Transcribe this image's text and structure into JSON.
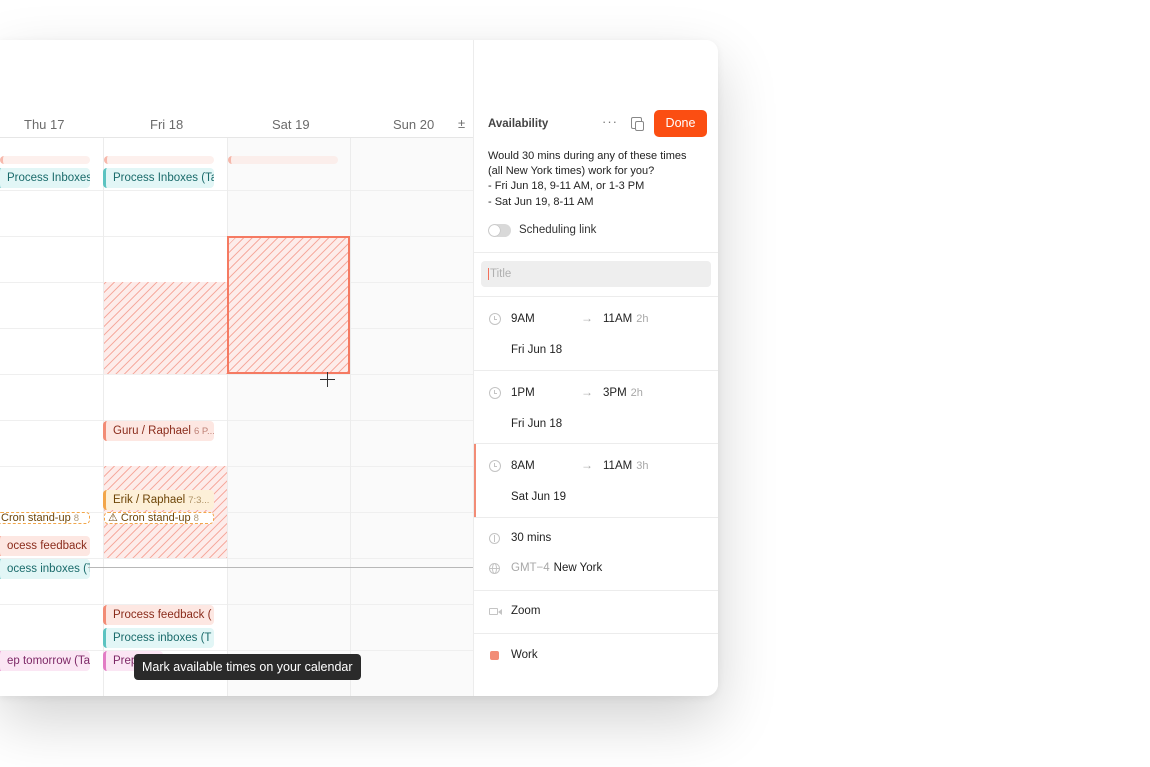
{
  "calendar": {
    "days": [
      {
        "label": "Thu 17"
      },
      {
        "label": "Fri 18"
      },
      {
        "label": "Sat 19"
      },
      {
        "label": "Sun 20"
      }
    ],
    "more_symbol": "±",
    "events": {
      "thu_process_inboxes_1": {
        "title": "Process Inboxes (T"
      },
      "fri_process_inboxes_1": {
        "title": "Process Inboxes (Ta"
      },
      "fri_guru": {
        "title": "Guru / Raphael",
        "time": "6 P..."
      },
      "fri_erik": {
        "title": "Erik / Raphael",
        "time": "7:3..."
      },
      "thu_cron": {
        "title": "Cron stand-up",
        "time": "8"
      },
      "fri_cron": {
        "title": "⚠ Cron stand-up",
        "time": "8"
      },
      "thu_process_feedback": {
        "title": "ocess feedback ("
      },
      "thu_process_inboxes_2": {
        "title": "ocess inboxes (T"
      },
      "fri_process_feedback": {
        "title": "Process feedback ("
      },
      "fri_process_inboxes_2": {
        "title": "Process inboxes (T"
      },
      "thu_prep": {
        "title": "ep tomorrow (Tas"
      },
      "fri_prep": {
        "title": "Prep"
      }
    },
    "tooltip": "Mark available times on your calendar"
  },
  "sidebar": {
    "title": "Availability",
    "more_label": "···",
    "done_label": "Done",
    "message_lines": [
      "Would 30 mins during any of these times",
      "(all New York times) work for you?",
      "- Fri Jun 18, 9-11 AM, or 1-3 PM",
      "- Sat Jun 19, 8-11 AM"
    ],
    "scheduling_link_label": "Scheduling link",
    "scheduling_link_enabled": false,
    "title_placeholder": "Title",
    "slots": [
      {
        "start": "9AM",
        "end": "11AM",
        "duration": "2h",
        "date": "Fri Jun 18"
      },
      {
        "start": "1PM",
        "end": "3PM",
        "duration": "2h",
        "date": "Fri Jun 18"
      },
      {
        "start": "8AM",
        "end": "11AM",
        "duration": "3h",
        "date": "Sat Jun 19"
      }
    ],
    "arrow": "→",
    "duration_label": "30 mins",
    "timezone_offset": "GMT−4",
    "timezone_city": "New York",
    "location": "Zoom",
    "calendar_name": "Work",
    "calendar_color": "#f28c76"
  },
  "colors": {
    "accent": "#fb4e12",
    "selection": "#f57a62"
  }
}
